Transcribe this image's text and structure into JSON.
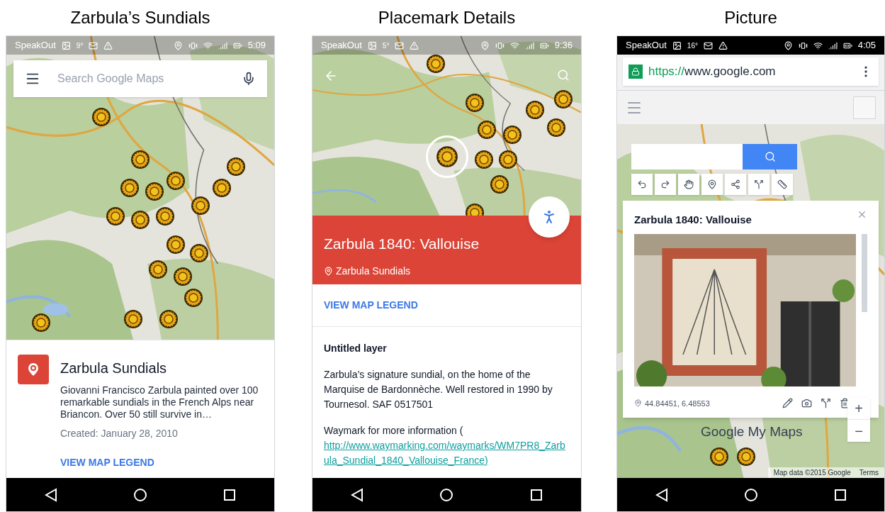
{
  "panels": [
    {
      "kind": "maps_app",
      "caption": "Zarbula’s Sundials",
      "status_bar": {
        "app": "SpeakOut",
        "temperature": "9°",
        "time": "5:09"
      },
      "search": {
        "placeholder": "Search Google Maps"
      },
      "card": {
        "title": "Zarbula Sundials",
        "description": "Giovanni Francisco Zarbula painted over 100 remarkable sundials in the French Alps near Briancon. Over 50 still survive in…",
        "created": "Created: January 28, 2010",
        "link": "VIEW MAP LEGEND"
      }
    },
    {
      "kind": "placemark",
      "caption": "Placemark Details",
      "status_bar": {
        "app": "SpeakOut",
        "temperature": "5°",
        "time": "9:36"
      },
      "header": {
        "title": "Zarbula 1840: Vallouise",
        "layer": "Zarbula Sundials"
      },
      "legend_link": "VIEW MAP LEGEND",
      "section_title": "Untitled layer",
      "paragraph": "Zarbula’s signature sundial, on the home of the Marquise de Bardonnèche. Well restored in 1990 by Tournesol. SAF 0517501",
      "info_text": "Waymark for more information (",
      "info_link": "http://www.waymarking.com/waymarks/WM7PR8_Zarbula_Sundial_1840_Vallouise_France)"
    },
    {
      "kind": "browser",
      "caption": "Picture",
      "status_bar": {
        "app": "SpeakOut",
        "temperature": "16°",
        "time": "4:05"
      },
      "url_scheme": "https://",
      "url_host": "www.google.com",
      "popup": {
        "title": "Zarbula 1840: Vallouise",
        "coords": "44.84451, 6.48553"
      },
      "zoom_in": "+",
      "zoom_out": "−",
      "logo": "Google My Maps",
      "attribution": "Map data ©2015 Google",
      "terms": "Terms"
    }
  ]
}
